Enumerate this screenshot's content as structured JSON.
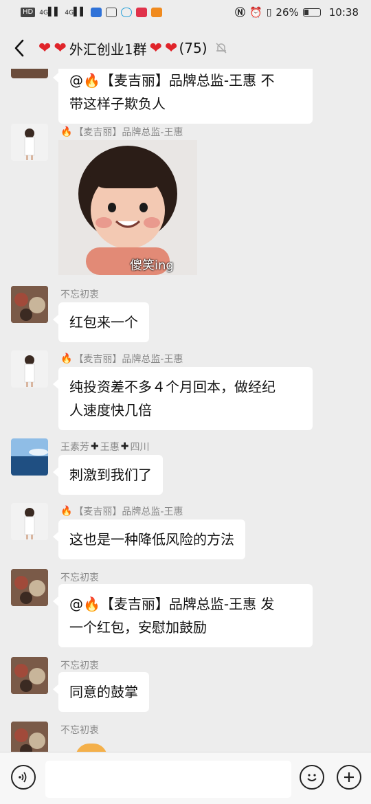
{
  "status_bar": {
    "left_icons": [
      "hd-icon",
      "signal-4g-icon",
      "signal-4g-icon",
      "shield-icon",
      "hand-icon",
      "cloud-icon",
      "app-icon",
      "video-icon"
    ],
    "hd_label": "HD",
    "net1": "4G",
    "net2": "4G",
    "battery_percent": "26%",
    "battery_level": 0.26,
    "time": "10:38"
  },
  "header": {
    "title_prefix_hearts": "❤️ ❤️",
    "title": "外汇创业1群",
    "title_suffix_hearts": "❤️ ❤️",
    "member_count": "(75)"
  },
  "messages": [
    {
      "sender": "",
      "text_line1": "@🔥【麦吉丽】品牌总监-王惠 不",
      "text_line2": "带这样子欺负人"
    },
    {
      "sender_prefix": "🔥",
      "sender": "【麦吉丽】品牌总监-王惠",
      "sticker_caption": "傻笑ing"
    },
    {
      "sender": "不忘初衷",
      "text": "红包来一个"
    },
    {
      "sender_prefix": "🔥",
      "sender": "【麦吉丽】品牌总监-王惠",
      "text_line1": "纯投资差不多４个月回本，做经纪",
      "text_line2": "人速度快几倍"
    },
    {
      "sender_parts": [
        "王素芳",
        "王惠",
        "四川"
      ],
      "text": "刺激到我们了"
    },
    {
      "sender_prefix": "🔥",
      "sender": "【麦吉丽】品牌总监-王惠",
      "text": "这也是一种降低风险的方法"
    },
    {
      "sender": "不忘初衷",
      "text_line1": "@🔥【麦吉丽】品牌总监-王惠  发",
      "text_line2": "一个红包，安慰加鼓励"
    },
    {
      "sender": "不忘初衷",
      "text": "同意的鼓掌"
    },
    {
      "sender": "不忘初衷"
    }
  ],
  "input_bar": {
    "voice_icon": "voice-icon",
    "emoji_icon": "emoji-icon",
    "plus_icon": "plus-icon"
  },
  "colors": {
    "background": "#ededed",
    "bubble": "#ffffff",
    "heart": "#e0242a"
  }
}
